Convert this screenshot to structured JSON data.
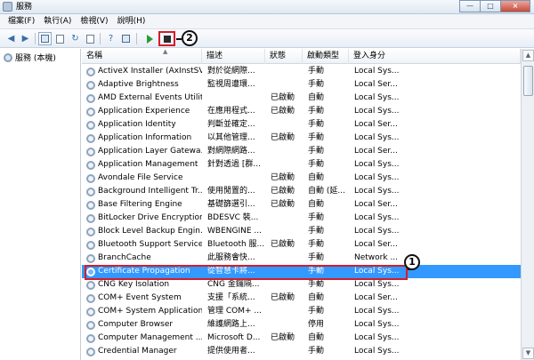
{
  "window": {
    "title": "服務",
    "minimize": "—",
    "maximize": "□",
    "close": "×"
  },
  "menu": [
    "檔案(F)",
    "執行(A)",
    "檢視(V)",
    "說明(H)"
  ],
  "toolbar_icons": [
    "back-icon",
    "forward-icon",
    "console-tree-icon",
    "properties-icon",
    "refresh-icon",
    "export-icon",
    "help-icon",
    "details-icon",
    "start-icon",
    "stop-icon"
  ],
  "tree": {
    "label": "服務 (本機)"
  },
  "annotations": {
    "callout_1": "1",
    "callout_2": "2"
  },
  "columns": {
    "name": "名稱",
    "description": "描述",
    "status": "狀態",
    "startup_type": "啟動類型",
    "logon_as": "登入身分"
  },
  "services": [
    {
      "name": "ActiveX Installer (AxInstSV)",
      "description": "對於從網際...",
      "status": "",
      "startup_type": "手動",
      "logon_as": "Local Sys..."
    },
    {
      "name": "Adaptive Brightness",
      "description": "監視周遭環...",
      "status": "",
      "startup_type": "手動",
      "logon_as": "Local Ser..."
    },
    {
      "name": "AMD External Events Utility",
      "description": "",
      "status": "已啟動",
      "startup_type": "自動",
      "logon_as": "Local Sys..."
    },
    {
      "name": "Application Experience",
      "description": "在應用程式...",
      "status": "已啟動",
      "startup_type": "手動",
      "logon_as": "Local Sys..."
    },
    {
      "name": "Application Identity",
      "description": "判斷並確定...",
      "status": "",
      "startup_type": "手動",
      "logon_as": "Local Ser..."
    },
    {
      "name": "Application Information",
      "description": "以其他管理...",
      "status": "已啟動",
      "startup_type": "手動",
      "logon_as": "Local Sys..."
    },
    {
      "name": "Application Layer Gatewa...",
      "description": "對網際網路...",
      "status": "",
      "startup_type": "手動",
      "logon_as": "Local Ser..."
    },
    {
      "name": "Application Management",
      "description": "針對透過 [群...",
      "status": "",
      "startup_type": "手動",
      "logon_as": "Local Sys..."
    },
    {
      "name": "Avondale File Service",
      "description": "",
      "status": "已啟動",
      "startup_type": "自動",
      "logon_as": "Local Sys..."
    },
    {
      "name": "Background Intelligent Tr...",
      "description": "使用閒置的...",
      "status": "已啟動",
      "startup_type": "自動 (延...",
      "logon_as": "Local Sys..."
    },
    {
      "name": "Base Filtering Engine",
      "description": "基礎篩選引...",
      "status": "已啟動",
      "startup_type": "自動",
      "logon_as": "Local Ser..."
    },
    {
      "name": "BitLocker Drive Encryption...",
      "description": "BDESVC 裝...",
      "status": "",
      "startup_type": "手動",
      "logon_as": "Local Sys..."
    },
    {
      "name": "Block Level Backup Engin...",
      "description": "WBENGINE ...",
      "status": "",
      "startup_type": "手動",
      "logon_as": "Local Sys..."
    },
    {
      "name": "Bluetooth Support Service",
      "description": "Bluetooth 服...",
      "status": "已啟動",
      "startup_type": "手動",
      "logon_as": "Local Ser..."
    },
    {
      "name": "BranchCache",
      "description": "此服務會快...",
      "status": "",
      "startup_type": "手動",
      "logon_as": "Network ..."
    },
    {
      "name": "Certificate Propagation",
      "description": "從智慧卡將...",
      "status": "",
      "startup_type": "手動",
      "logon_as": "Local Sys..."
    },
    {
      "name": "CNG Key Isolation",
      "description": "CNG 金鑰隔...",
      "status": "",
      "startup_type": "手動",
      "logon_as": "Local Sys..."
    },
    {
      "name": "COM+ Event System",
      "description": "支援「系統...",
      "status": "已啟動",
      "startup_type": "自動",
      "logon_as": "Local Ser..."
    },
    {
      "name": "COM+ System Application",
      "description": "管理 COM+ ...",
      "status": "",
      "startup_type": "手動",
      "logon_as": "Local Sys..."
    },
    {
      "name": "Computer Browser",
      "description": "維護網路上...",
      "status": "",
      "startup_type": "停用",
      "logon_as": "Local Sys..."
    },
    {
      "name": "Computer Management ...",
      "description": "Microsoft D...",
      "status": "已啟動",
      "startup_type": "自動",
      "logon_as": "Local Sys..."
    },
    {
      "name": "Credential Manager",
      "description": "提供使用者...",
      "status": "",
      "startup_type": "手動",
      "logon_as": "Local Sys..."
    }
  ]
}
